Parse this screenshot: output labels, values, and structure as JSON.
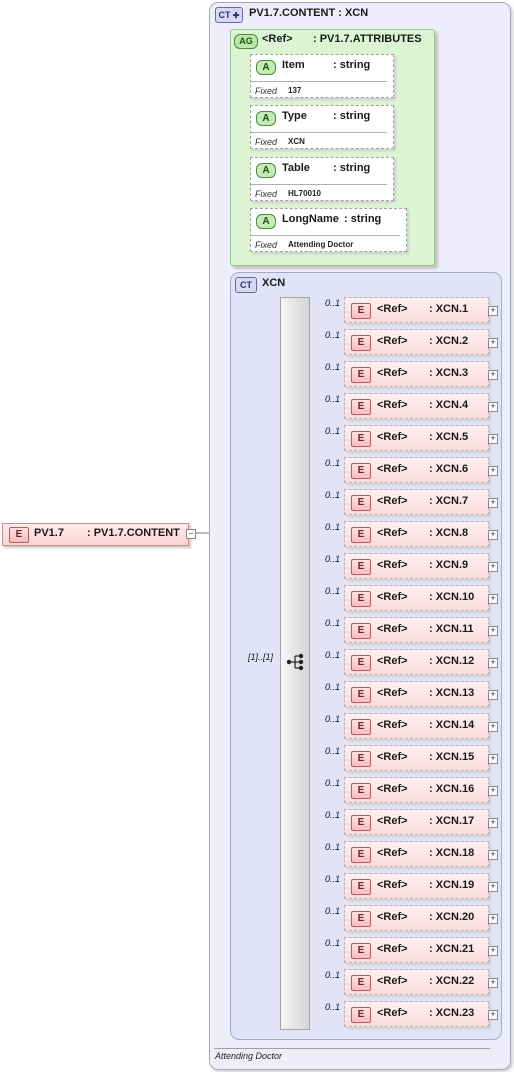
{
  "root": {
    "badge": "E",
    "name": "PV1.7",
    "type": ": PV1.7.CONTENT",
    "collapse_glyph": "−"
  },
  "complex_type": {
    "badge": "CT",
    "title": "PV1.7.CONTENT : XCN",
    "attribute_group": {
      "badge": "AG",
      "ref": "<Ref>",
      "type": ": PV1.7.ATTRIBUTES",
      "attributes": [
        {
          "badge": "A",
          "name": "Item",
          "type": ": string",
          "fixed_label": "Fixed",
          "fixed_value": "137"
        },
        {
          "badge": "A",
          "name": "Type",
          "type": ": string",
          "fixed_label": "Fixed",
          "fixed_value": "XCN"
        },
        {
          "badge": "A",
          "name": "Table",
          "type": ": string",
          "fixed_label": "Fixed",
          "fixed_value": "HL70010"
        },
        {
          "badge": "A",
          "name": "LongName",
          "type": ": string",
          "fixed_label": "Fixed",
          "fixed_value": "Attending Doctor"
        }
      ]
    },
    "inner": {
      "badge": "CT",
      "title": "XCN",
      "sequence_multiplicity": "[1]..[1]",
      "elements": [
        {
          "mult": "0..1",
          "ref": "<Ref>",
          "type": ": XCN.1"
        },
        {
          "mult": "0..1",
          "ref": "<Ref>",
          "type": ": XCN.2"
        },
        {
          "mult": "0..1",
          "ref": "<Ref>",
          "type": ": XCN.3"
        },
        {
          "mult": "0..1",
          "ref": "<Ref>",
          "type": ": XCN.4"
        },
        {
          "mult": "0..1",
          "ref": "<Ref>",
          "type": ": XCN.5"
        },
        {
          "mult": "0..1",
          "ref": "<Ref>",
          "type": ": XCN.6"
        },
        {
          "mult": "0..1",
          "ref": "<Ref>",
          "type": ": XCN.7"
        },
        {
          "mult": "0..1",
          "ref": "<Ref>",
          "type": ": XCN.8"
        },
        {
          "mult": "0..1",
          "ref": "<Ref>",
          "type": ": XCN.9"
        },
        {
          "mult": "0..1",
          "ref": "<Ref>",
          "type": ": XCN.10"
        },
        {
          "mult": "0..1",
          "ref": "<Ref>",
          "type": ": XCN.11"
        },
        {
          "mult": "0..1",
          "ref": "<Ref>",
          "type": ": XCN.12"
        },
        {
          "mult": "0..1",
          "ref": "<Ref>",
          "type": ": XCN.13"
        },
        {
          "mult": "0..1",
          "ref": "<Ref>",
          "type": ": XCN.14"
        },
        {
          "mult": "0..1",
          "ref": "<Ref>",
          "type": ": XCN.15"
        },
        {
          "mult": "0..1",
          "ref": "<Ref>",
          "type": ": XCN.16"
        },
        {
          "mult": "0..1",
          "ref": "<Ref>",
          "type": ": XCN.17"
        },
        {
          "mult": "0..1",
          "ref": "<Ref>",
          "type": ": XCN.18"
        },
        {
          "mult": "0..1",
          "ref": "<Ref>",
          "type": ": XCN.19"
        },
        {
          "mult": "0..1",
          "ref": "<Ref>",
          "type": ": XCN.20"
        },
        {
          "mult": "0..1",
          "ref": "<Ref>",
          "type": ": XCN.21"
        },
        {
          "mult": "0..1",
          "ref": "<Ref>",
          "type": ": XCN.22"
        },
        {
          "mult": "0..1",
          "ref": "<Ref>",
          "type": ": XCN.23"
        }
      ],
      "element_badge": "E",
      "expand_glyph": "+"
    },
    "documentation": "Attending Doctor"
  }
}
